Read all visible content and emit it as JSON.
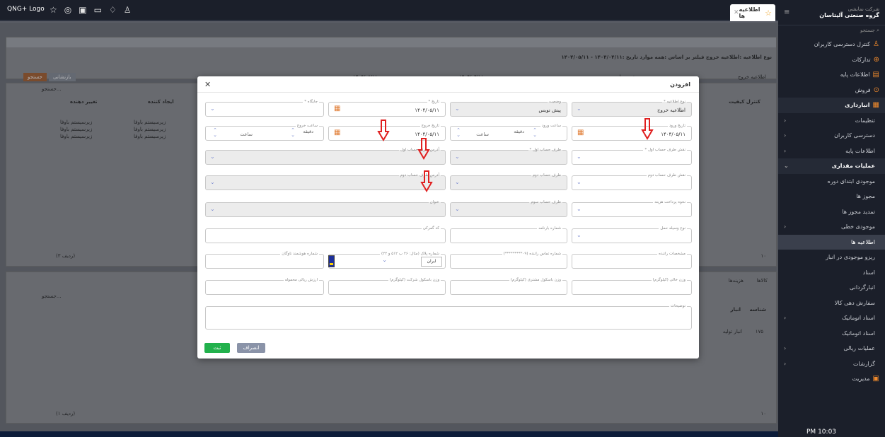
{
  "topbar": {
    "logo": "QNG+ Logo",
    "tab_label": "اطلاعیه ها"
  },
  "sidebar": {
    "org_sub": "شرکت نمایشی",
    "org_title": "گروه صنعتی آلیتاسان",
    "search": "جستجو",
    "items": [
      {
        "label": "کنترل دسترسی کاربران"
      },
      {
        "label": "تدارکات"
      },
      {
        "label": "اطلاعات پایه"
      },
      {
        "label": "فروش"
      },
      {
        "label": "انبارداری"
      },
      {
        "label": "تنظیمات"
      },
      {
        "label": "دسترسی کاربران"
      },
      {
        "label": "اطلاعات پایه"
      },
      {
        "label": "عملیات مقداری"
      },
      {
        "label": "موجودی ابتدای دوره"
      },
      {
        "label": "مجوز ها"
      },
      {
        "label": "تمدید مجوز ها"
      },
      {
        "label": "موجودی خطی"
      },
      {
        "label": "اطلاعیه ها"
      },
      {
        "label": "ریزو موجودی در انبار"
      },
      {
        "label": "اسناد"
      },
      {
        "label": "انبارگردانی"
      },
      {
        "label": "سفارش دهی کالا"
      },
      {
        "label": "اسناد اتوماتیک"
      },
      {
        "label": "اسناد اتوماتیک"
      },
      {
        "label": "عملیات ریالی"
      },
      {
        "label": "گزارشات"
      },
      {
        "label": "مدیریت"
      }
    ],
    "clock": "10:03 PM"
  },
  "background": {
    "filter_text": "نوع اطلاعیه :اطلاعیه خروج  فیلتر بر اساس :همه موارد  تاریخ :۱۴۰۴/۰۴/۱۱ - ۱۴۰۴/۰۵/۱۱",
    "notice_type_value": "اطلاعیه خروج",
    "filter_value": "همه موارد",
    "from_date": "۱۴۰۴/۰۴/۱۱",
    "to_date": "۱۴۰۴/۰۵/۱۱",
    "search_btn": "جستجو",
    "reset_btn": "بازنشانی",
    "search_placeholder": "جستجو...",
    "col_changer": "تغییر دهنده",
    "col_creator": "ایجاد کننده",
    "col_status": "کنترل کیفیت",
    "row_value": "زیرسیستم باوفا",
    "pager_top": "(۳ ردیف)",
    "pager_bottom": "(۱ ردیف)",
    "tab_goods": "کالاها",
    "tab_costs": "هزینه‌ها",
    "col_id": "شناسه",
    "col_store": "انبار",
    "row_id": "۱۷۵",
    "row_store": "انبار تولید",
    "page_size": "۱۰"
  },
  "modal": {
    "title": "افزودن",
    "f_type_label": "نوع اطلاعیه *",
    "f_type_value": "اطلاعیه خروج",
    "f_status_label": "وضعیت",
    "f_status_value": "پیش نویس",
    "f_date_label": "تاریخ *",
    "f_date_value": "۱۴۰۴/۰۵/۱۱",
    "f_station_label": "جایگاه *",
    "f_entry_date_label": "تاریخ ورود",
    "f_entry_date_value": "۱۴۰۴/۰۵/۱۱",
    "f_entry_time_label": "ساعت ورود",
    "f_exit_date_label": "تاریخ خروج",
    "f_exit_date_value": "۱۴۰۴/۰۵/۱۱",
    "f_exit_time_label": "ساعت خروج",
    "minute": "دقیقه",
    "hour": "ساعت",
    "f_party1_role_label": "نقش طرف حساب اول *",
    "f_party1_label": "طرف حساب اول *",
    "f_party1_code_label": "آدرس طرف حساب اول",
    "f_party2_role_label": "نقش طرف حساب دوم",
    "f_party2_label": "طرف حساب دوم",
    "f_party2_code_label": "آدرس طرف حساب دوم",
    "f_payment_label": "نحوه پرداخت هزینه",
    "f_party3_label": "طرف حساب سوم",
    "f_address_label": "عنوان",
    "f_vehicle_label": "نوع وسیله حمل",
    "f_cargo_label": "شماره بارنامه",
    "f_customs_label": "کد گمرکی",
    "f_driver_label": "مشخصات راننده",
    "f_phone_label": "شماره تماس راننده (۰۹*********)",
    "f_plate_label": "شماره پلاک (مثال: ۲۶ ب ۵۱۲ و ۲۲)",
    "f_plate_country": "ایران",
    "f_smart_label": "شماره هوشمند ناوگان",
    "f_empty_weight_label": "وزن خالی (کیلوگرم)",
    "f_net_weight_label": "وزن باسکول مشتری (کیلوگرم)",
    "f_company_weight_label": "وزن باسکول شرکت (کیلوگرم)",
    "f_value_label": "ارزش ریالی محموله",
    "f_desc_label": "توضیحات",
    "btn_submit": "ثبت",
    "btn_cancel": "انصراف"
  },
  "colors": {
    "accent": "#f08a2c",
    "submit": "#22b14c",
    "cancel": "#8a93a8",
    "arrow": "#e02020"
  }
}
